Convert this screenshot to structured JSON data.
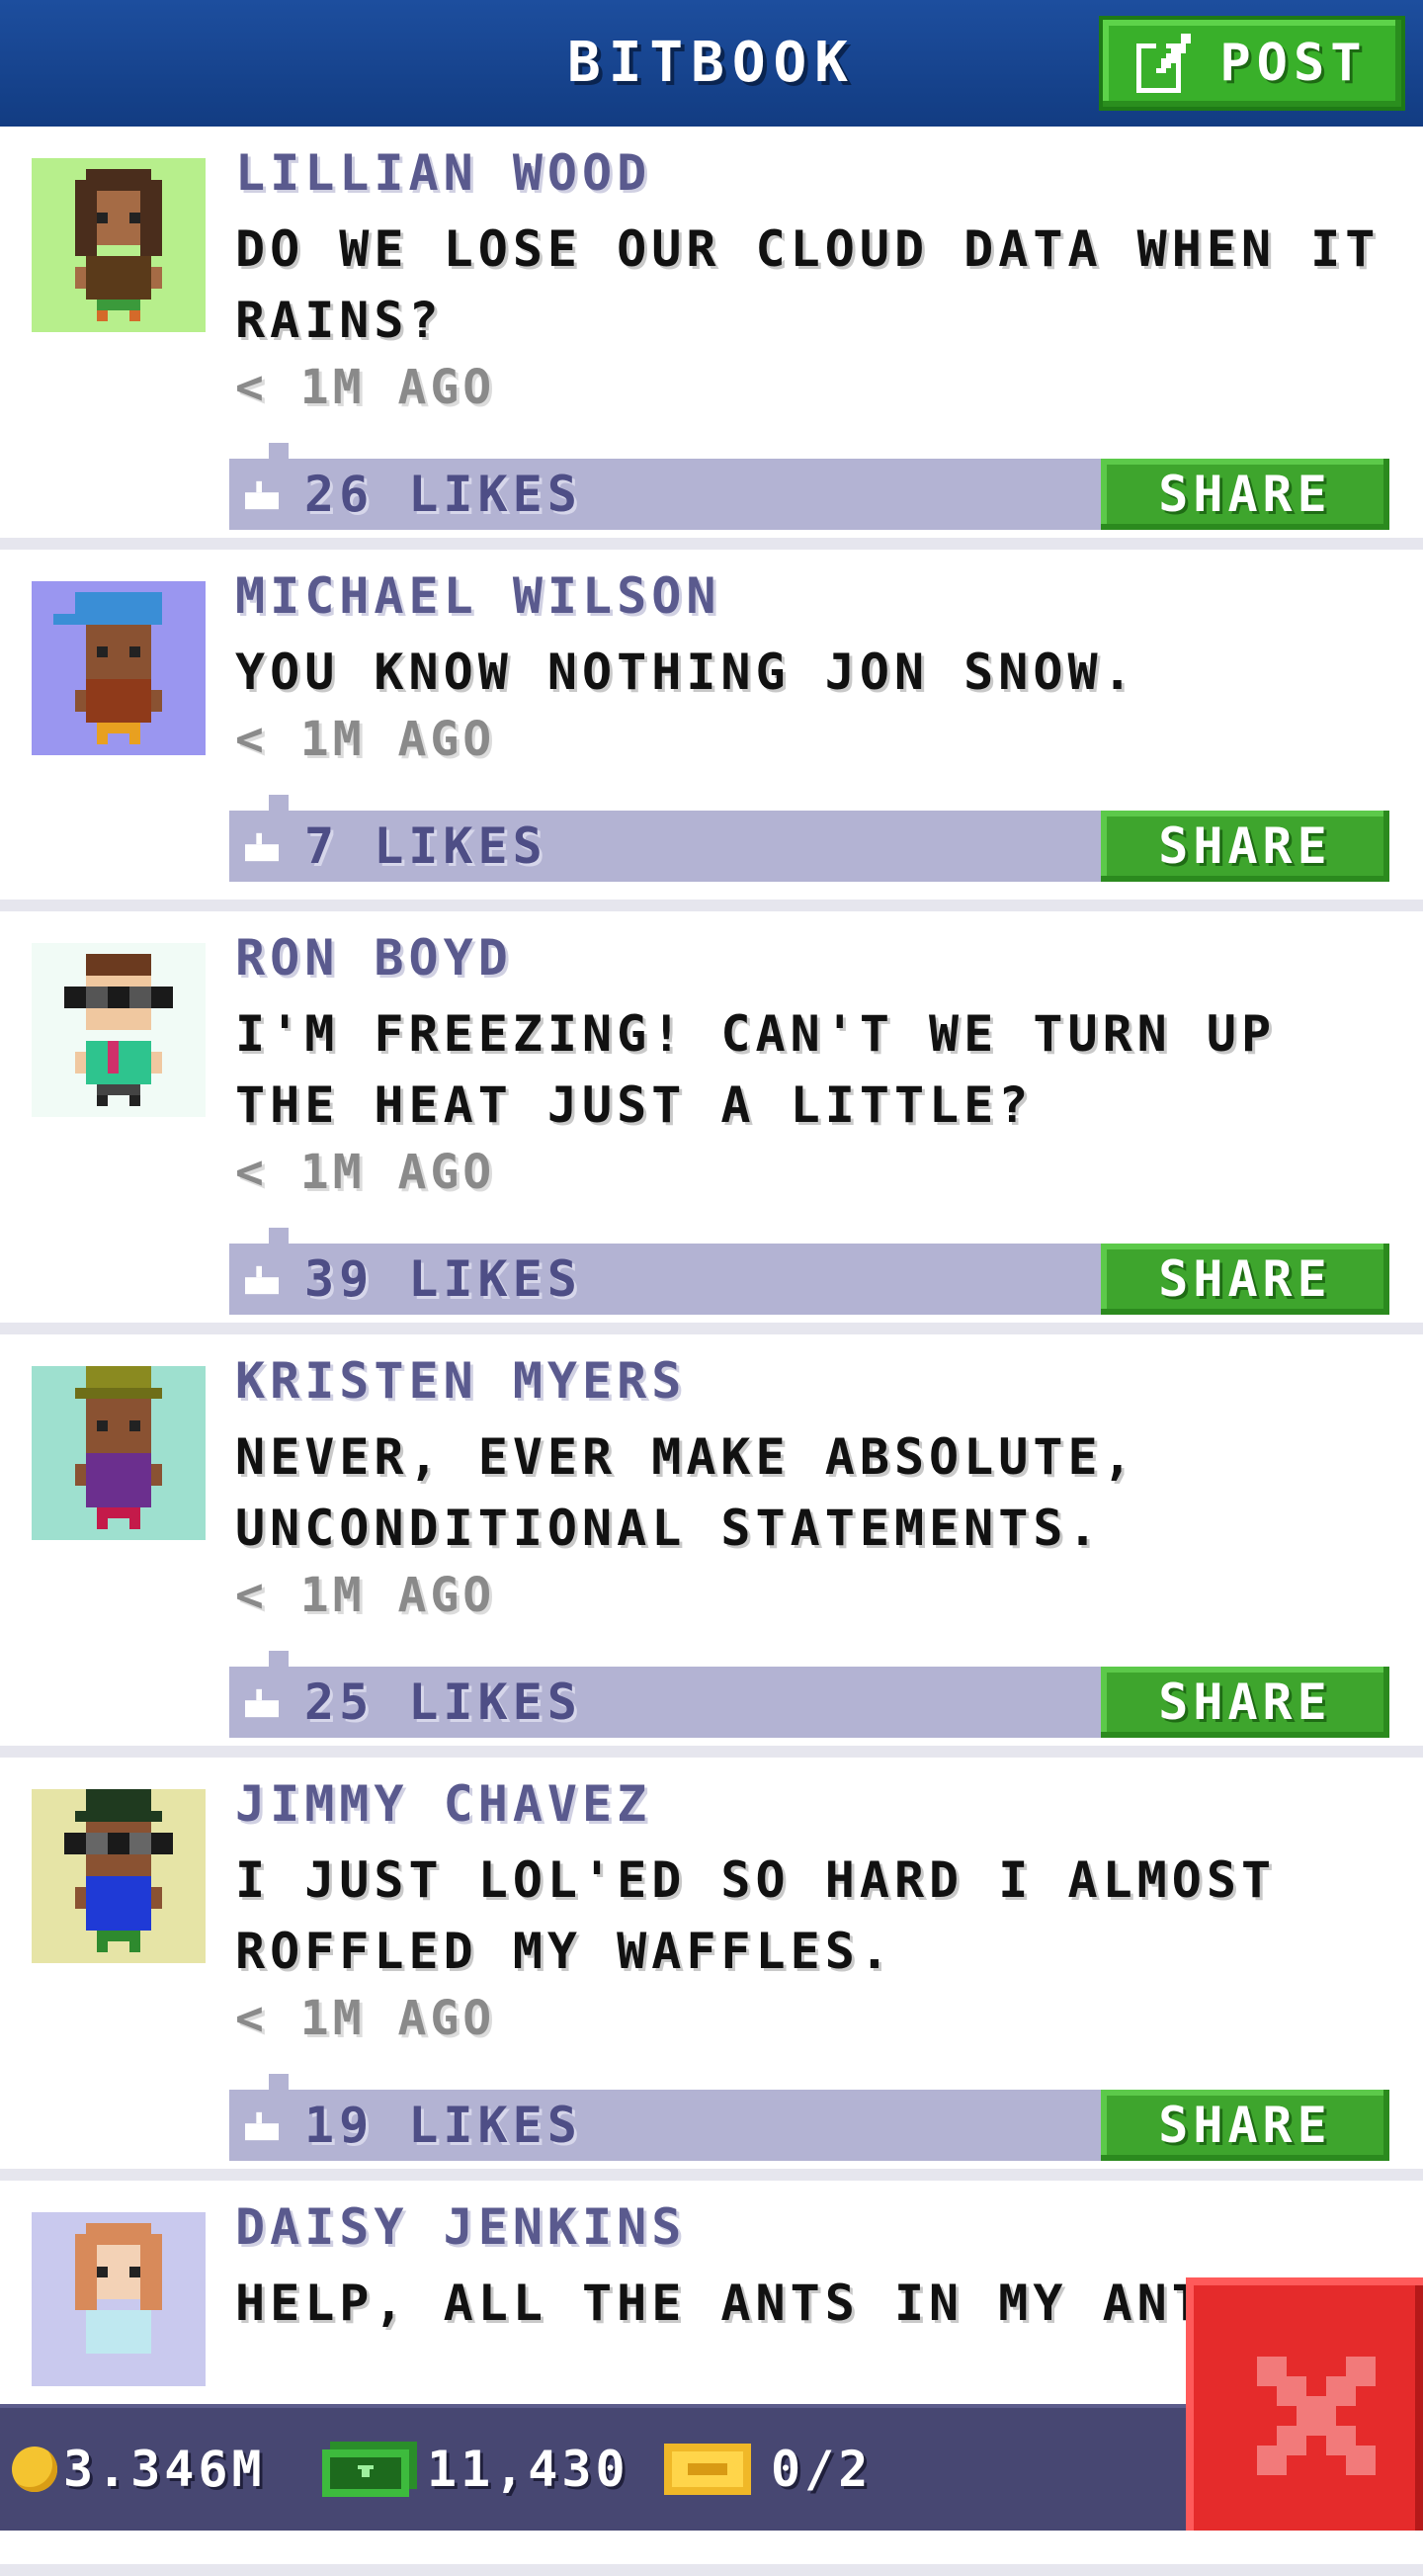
{
  "header": {
    "title": "BITBOOK",
    "post_label": "POST"
  },
  "posts": [
    {
      "name": "LILLIAN WOOD",
      "message": "DO WE LOSE OUR CLOUD DATA WHEN IT RAINS?",
      "time": "< 1M AGO",
      "likes": "26 LIKES",
      "share_label": "SHARE",
      "avatar_bg": "#b7ef8c"
    },
    {
      "name": "MICHAEL WILSON",
      "message": "YOU KNOW NOTHING JON SNOW.",
      "time": "< 1M AGO",
      "likes": "7 LIKES",
      "share_label": "SHARE",
      "avatar_bg": "#9a96f0"
    },
    {
      "name": "RON BOYD",
      "message": "I'M FREEZING! CAN'T WE TURN UP THE HEAT JUST A LITTLE?",
      "time": "< 1M AGO",
      "likes": "39 LIKES",
      "share_label": "SHARE",
      "avatar_bg": "#f1fbf6"
    },
    {
      "name": "KRISTEN MYERS",
      "message": "NEVER, EVER MAKE ABSOLUTE, UNCONDITIONAL STATEMENTS.",
      "time": "< 1M AGO",
      "likes": "25 LIKES",
      "share_label": "SHARE",
      "avatar_bg": "#9ee0cf"
    },
    {
      "name": "JIMMY CHAVEZ",
      "message": "I JUST LOL'ED SO HARD I ALMOST ROFFLED MY WAFFLES.",
      "time": "< 1M AGO",
      "likes": "19 LIKES",
      "share_label": "SHARE",
      "avatar_bg": "#e6e4a6"
    },
    {
      "name": "DAISY JENKINS",
      "message": "HELP, ALL THE ANTS IN MY ANT",
      "avatar_bg": "#c9c9ee"
    }
  ],
  "status": {
    "coins": "3.346M",
    "bux": "11,430",
    "tickets": "0/2"
  },
  "icons": {
    "post": "edit-icon",
    "like": "thumbs-up-icon",
    "coin": "coin-icon",
    "bux": "bitbux-icon",
    "ticket": "vip-ticket-icon",
    "close": "close-icon"
  },
  "colors": {
    "header": "#1d4e9e",
    "accent_green": "#3ea52d",
    "likes_bar": "#b3b3d3",
    "close_red": "#e52b2b"
  }
}
